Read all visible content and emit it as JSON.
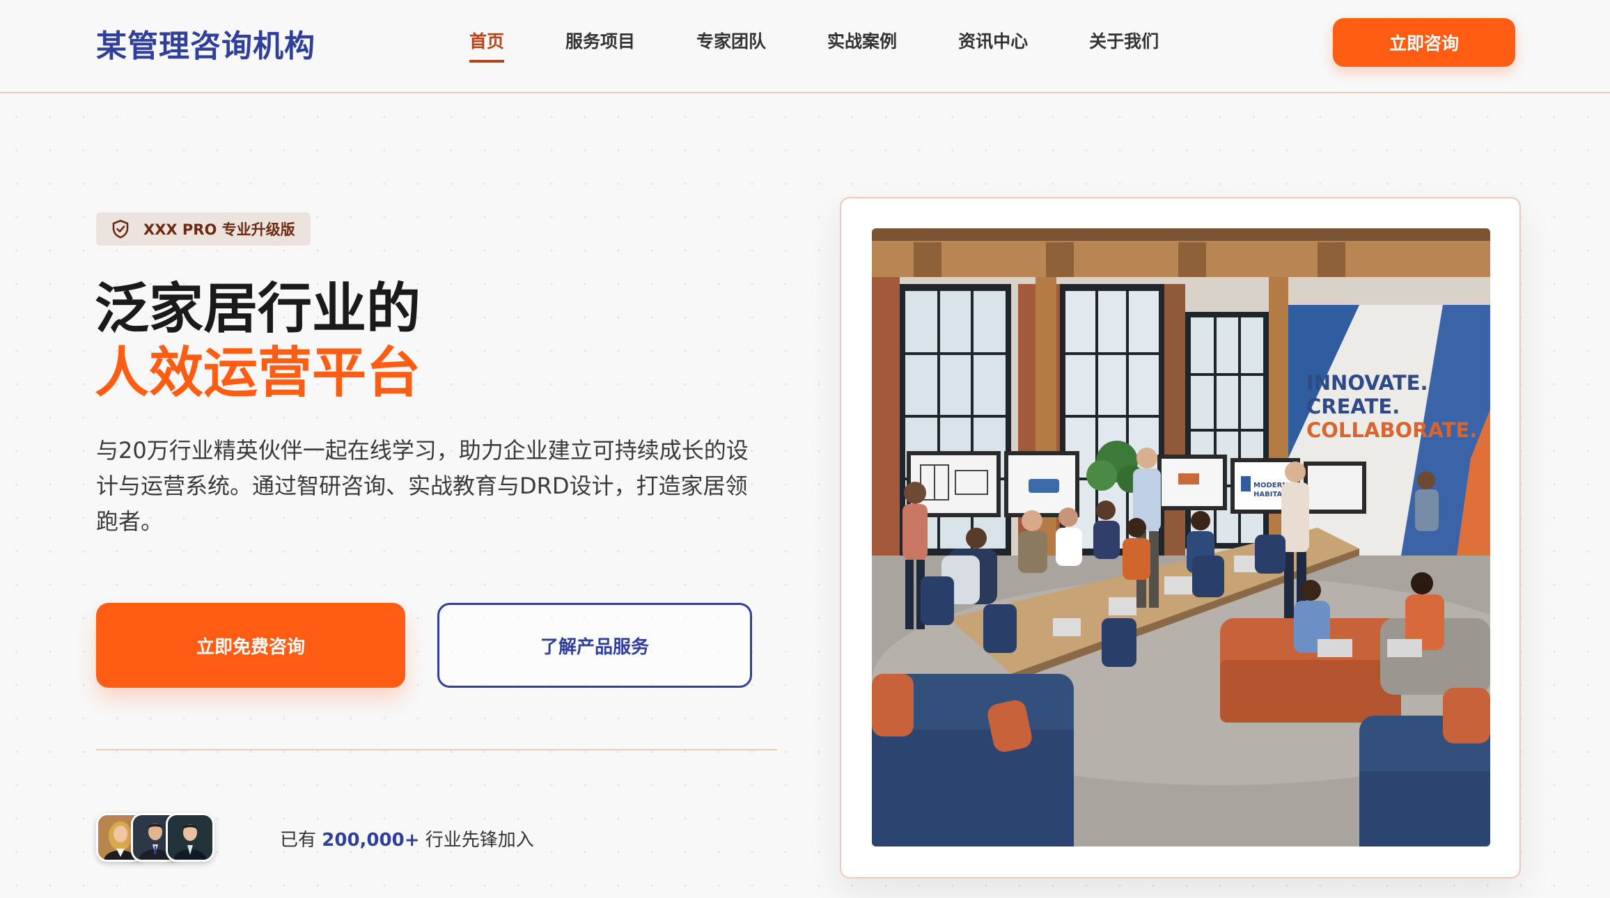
{
  "header": {
    "logo": "某管理咨询机构",
    "nav": [
      "首页",
      "服务项目",
      "专家团队",
      "实战案例",
      "资讯中心",
      "关于我们"
    ],
    "active_index": 0,
    "cta": "立即咨询"
  },
  "hero": {
    "badge": "XXX PRO 专业升级版",
    "title_line1": "泛家居行业的",
    "title_line2": "人效运营平台",
    "description": "与20万行业精英伙伴一起在线学习，助力企业建立可持续成长的设计与运营系统。通过智研咨询、实战教育与DRD设计，打造家居领跑者。",
    "primary_button": "立即免费咨询",
    "secondary_button": "了解产品服务",
    "social_prefix": "已有",
    "social_count": "200,000+",
    "social_suffix": "行业先锋加入"
  },
  "photo": {
    "wall_text": [
      "INNOVATE.",
      "CREATE.",
      "COLLABORATE."
    ],
    "screen_brand": [
      "MODERN",
      "HABITAT"
    ]
  },
  "colors": {
    "brand_blue": "#2f3f9a",
    "accent_orange": "#ff5c14",
    "nav_active": "#b2461a"
  },
  "icons": [
    "shield-check-icon"
  ]
}
